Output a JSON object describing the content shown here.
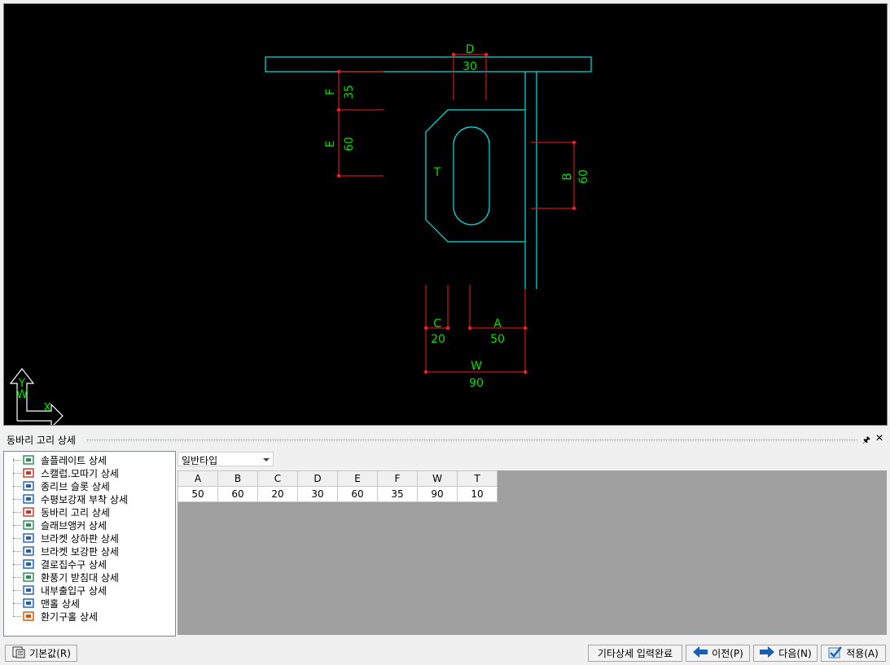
{
  "panel": {
    "title": "동바리 고리 상세"
  },
  "drawing": {
    "labels": {
      "D": "D",
      "D_val": "30",
      "F": "F",
      "F_val": "35",
      "E": "E",
      "E_val": "60",
      "T": "T",
      "B": "B",
      "B_val": "60",
      "C": "C",
      "C_val": "20",
      "A": "A",
      "A_val": "50",
      "W": "W",
      "W_val": "90"
    },
    "ucs": {
      "y": "Y",
      "w": "W",
      "x": "X"
    },
    "colors": {
      "outline": "#00e5e5",
      "dimension": "#ff1a1a",
      "text": "#00e000",
      "background": "#000000"
    }
  },
  "tree": {
    "items": [
      {
        "label": "솔플레이트 상세",
        "icon": "sole-plate-icon"
      },
      {
        "label": "스캘럽.모따기 상세",
        "icon": "scallop-icon"
      },
      {
        "label": "종리브 슬롯 상세",
        "icon": "rib-slot-icon"
      },
      {
        "label": "수평보강재 부착 상세",
        "icon": "stiffener-icon"
      },
      {
        "label": "동바리 고리 상세",
        "icon": "support-hook-icon"
      },
      {
        "label": "슬래브앵커 상세",
        "icon": "slab-anchor-icon"
      },
      {
        "label": "브라켓 상하판 상세",
        "icon": "bracket-flange-icon"
      },
      {
        "label": "브라켓 보강판 상세",
        "icon": "bracket-stiffener-icon"
      },
      {
        "label": "결로집수구 상세",
        "icon": "condensation-drain-icon"
      },
      {
        "label": "환풍기 받침대 상세",
        "icon": "fan-support-icon"
      },
      {
        "label": "내부출입구 상세",
        "icon": "inner-entrance-icon"
      },
      {
        "label": "맨홀 상세",
        "icon": "manhole-icon"
      },
      {
        "label": "환기구홀 상세",
        "icon": "vent-hole-icon"
      }
    ]
  },
  "type_select": {
    "value": "일반타입"
  },
  "grid": {
    "headers": [
      "A",
      "B",
      "C",
      "D",
      "E",
      "F",
      "W",
      "T"
    ],
    "values": [
      "50",
      "60",
      "20",
      "30",
      "60",
      "35",
      "90",
      "10"
    ]
  },
  "buttons": {
    "default": "기본값(R)",
    "complete": "기타상세 입력완료",
    "prev": "이전(P)",
    "next": "다음(N)",
    "apply": "적용(A)"
  }
}
